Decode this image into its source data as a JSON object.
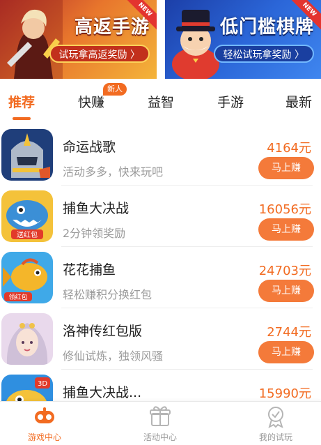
{
  "banners": [
    {
      "title": "高返手游",
      "cta": "试玩拿高返奖励 〉",
      "ribbon": "NEW"
    },
    {
      "title": "低门槛棋牌",
      "cta": "轻松试玩拿奖励 〉",
      "ribbon": "NEW"
    }
  ],
  "tabs": [
    {
      "label": "推荐",
      "active": true
    },
    {
      "label": "快赚",
      "badge": "新人"
    },
    {
      "label": "益智"
    },
    {
      "label": "手游"
    },
    {
      "label": "最新"
    }
  ],
  "games": [
    {
      "name": "命运战歌",
      "desc": "活动多多，快来玩吧",
      "amount": "4164元",
      "button": "马上赚",
      "icon": "knight-helmet-icon"
    },
    {
      "name": "捕鱼大决战",
      "desc": "2分钟领奖励",
      "amount": "16056元",
      "button": "马上赚",
      "icon": "shark-icon",
      "icon_text": "送红包"
    },
    {
      "name": "花花捕鱼",
      "desc": "轻松赚积分换红包",
      "amount": "24703元",
      "button": "马上赚",
      "icon": "goldfish-icon",
      "icon_text": "领红包"
    },
    {
      "name": "洛神传红包版",
      "desc": "修仙试炼，独领风骚",
      "amount": "2744元",
      "button": "马上赚",
      "icon": "fairy-portrait-icon"
    },
    {
      "name": "捕鱼大决战...",
      "desc": "",
      "amount": "15990元",
      "button": "",
      "icon": "fish-3d-icon",
      "icon_text": "3D"
    }
  ],
  "bottom_nav": [
    {
      "label": "游戏中心",
      "icon": "gamepad-icon",
      "active": true
    },
    {
      "label": "活动中心",
      "icon": "gift-box-icon"
    },
    {
      "label": "我的试玩",
      "icon": "medal-icon"
    }
  ],
  "colors": {
    "accent": "#f26b21",
    "button": "#f47a3a"
  }
}
